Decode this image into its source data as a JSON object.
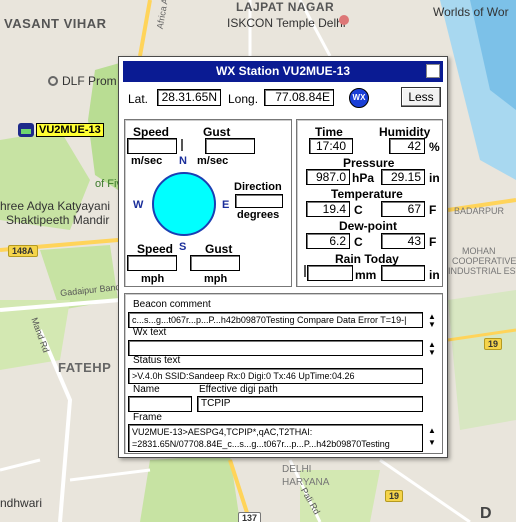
{
  "map": {
    "labels": {
      "vasant_vihar": "VASANT VIHAR",
      "lajpat_nagar": "LAJPAT NAGAR",
      "iskcon": "ISKCON Temple Delhi",
      "worlds_of_wonder": "Worlds of Wor",
      "dlf_prom": "DLF Prom",
      "of_five": "of Fiv",
      "shree_adya": "hree Adya Katyayani",
      "shaktipeeth": "Shaktipeeth Mandir",
      "gadaipur": "Gadaipur Bandh Rd",
      "mand_rd": "Mand Rd",
      "fatehpur": "FATEHP",
      "andhwari": "ndhwari",
      "badarpur": "BADARPUR",
      "mohan_coop": "MOHAN",
      "mohan_coop2": "COOPERATIVE",
      "mohan_coop3": "INDUSTRIAL ESTATE",
      "delhi": "DELHI",
      "haryana": "HARYANA",
      "pali_rd": "Pali Rd",
      "africa_ave": "Africa Ave",
      "d_label": "D"
    },
    "shields": {
      "s148a": "148A",
      "s19a": "19",
      "s19b": "19",
      "s137": "137"
    },
    "station_tag": "VU2MUE-13"
  },
  "dialog": {
    "title": "WX Station  VU2MUE-13",
    "lat_label": "Lat.",
    "lat_value": "28.31.65N",
    "long_label": "Long.",
    "long_value": "77.08.84E",
    "logo_text": "WX",
    "less_label": "Less",
    "wind": {
      "speed_label": "Speed",
      "gust_label": "Gust",
      "speed_unit": "m/sec",
      "gust_unit": "m/sec",
      "n": "N",
      "s": "S",
      "e": "E",
      "w": "W",
      "direction_label": "Direction",
      "direction_unit": "degrees",
      "speed2_label": "Speed",
      "gust2_label": "Gust",
      "speed2_unit": "mph",
      "gust2_unit": "mph"
    },
    "readings": {
      "time_label": "Time",
      "time_value": "17:40",
      "humidity_label": "Humidity",
      "humidity_value": "42",
      "humidity_unit": "%",
      "pressure_label": "Pressure",
      "pressure_hpa": "987.0",
      "pressure_hpa_unit": "hPa",
      "pressure_in": "29.15",
      "pressure_in_unit": "in",
      "temperature_label": "Temperature",
      "temp_c": "19.4",
      "temp_c_unit": "C",
      "temp_f": "67",
      "temp_f_unit": "F",
      "dewpoint_label": "Dew-point",
      "dew_c": "6.2",
      "dew_c_unit": "C",
      "dew_f": "43",
      "dew_f_unit": "F",
      "rain_label": "Rain Today",
      "rain_mm_unit": "mm",
      "rain_in_unit": "in"
    },
    "beacon_label": "Beacon comment",
    "beacon_text": "c...s...g...t067r...p...P...h42b09870Testing Compare Data Error T=19-|",
    "wx_text_label": "Wx text",
    "status_label": "Status text",
    "status_text": ">V.4.0h SSID:Sandeep Rx:0 Digi:0 Tx:46 UpTime:04.26",
    "name_label": "Name",
    "digi_label": "Effective digi path",
    "digi_value": "TCPIP",
    "frame_label": "Frame",
    "frame_line1": "VU2MUE-13>AESPG4,TCPIP*,qAC,T2THAI:",
    "frame_line2": "=2831.65N/07708.84E_c...s...g...t067r...p...P...h42b09870Testing"
  }
}
